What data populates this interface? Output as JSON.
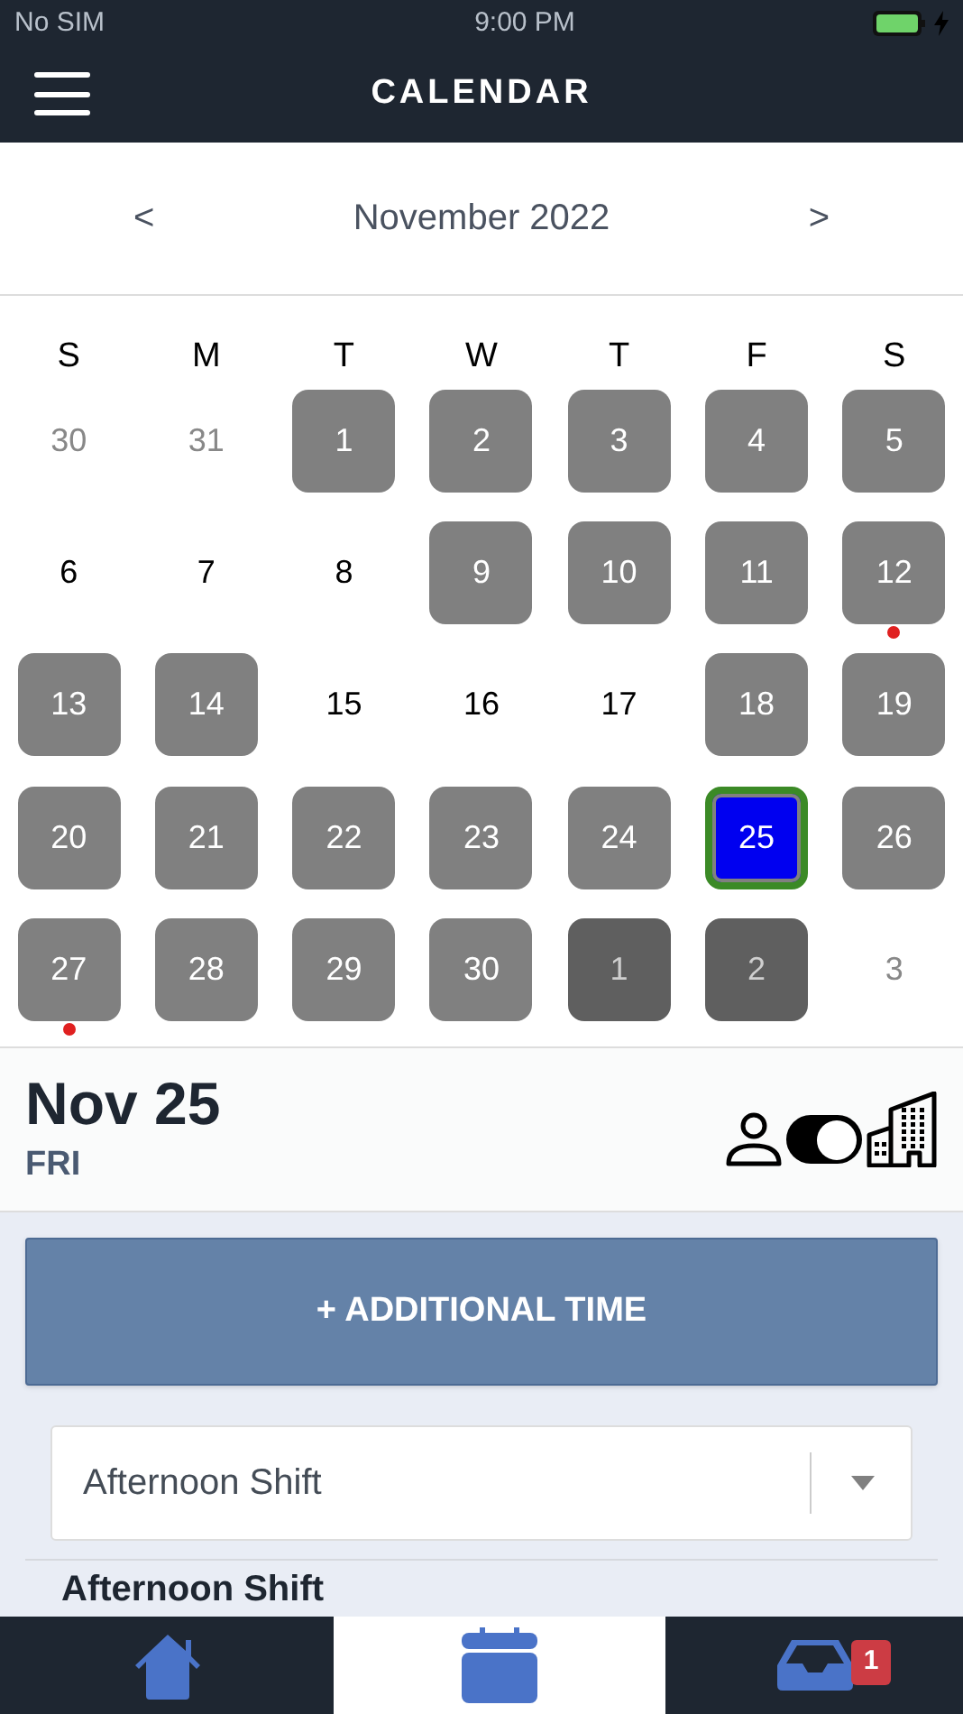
{
  "status_bar": {
    "carrier": "No SIM",
    "time": "9:00 PM",
    "charging": true
  },
  "header": {
    "title": "CALENDAR"
  },
  "month_nav": {
    "prev": "<",
    "label": "November 2022",
    "next": ">"
  },
  "weekdays": [
    "S",
    "M",
    "T",
    "W",
    "T",
    "F",
    "S"
  ],
  "days": [
    {
      "label": "30",
      "kind": "outside",
      "selected": false,
      "dot": false
    },
    {
      "label": "31",
      "kind": "outside",
      "selected": false,
      "dot": false
    },
    {
      "label": "1",
      "kind": "shift",
      "selected": false,
      "dot": false
    },
    {
      "label": "2",
      "kind": "shift",
      "selected": false,
      "dot": false
    },
    {
      "label": "3",
      "kind": "shift",
      "selected": false,
      "dot": false
    },
    {
      "label": "4",
      "kind": "shift",
      "selected": false,
      "dot": false
    },
    {
      "label": "5",
      "kind": "shift",
      "selected": false,
      "dot": false
    },
    {
      "label": "6",
      "kind": "plain",
      "selected": false,
      "dot": false
    },
    {
      "label": "7",
      "kind": "plain",
      "selected": false,
      "dot": false
    },
    {
      "label": "8",
      "kind": "plain",
      "selected": false,
      "dot": false
    },
    {
      "label": "9",
      "kind": "shift",
      "selected": false,
      "dot": false
    },
    {
      "label": "10",
      "kind": "shift",
      "selected": false,
      "dot": false
    },
    {
      "label": "11",
      "kind": "shift",
      "selected": false,
      "dot": false
    },
    {
      "label": "12",
      "kind": "shift",
      "selected": false,
      "dot": true
    },
    {
      "label": "13",
      "kind": "shift",
      "selected": false,
      "dot": false
    },
    {
      "label": "14",
      "kind": "shift",
      "selected": false,
      "dot": false
    },
    {
      "label": "15",
      "kind": "plain",
      "selected": false,
      "dot": false
    },
    {
      "label": "16",
      "kind": "plain",
      "selected": false,
      "dot": false
    },
    {
      "label": "17",
      "kind": "plain",
      "selected": false,
      "dot": false
    },
    {
      "label": "18",
      "kind": "shift",
      "selected": false,
      "dot": false
    },
    {
      "label": "19",
      "kind": "shift",
      "selected": false,
      "dot": false
    },
    {
      "label": "20",
      "kind": "shift",
      "selected": false,
      "dot": false
    },
    {
      "label": "21",
      "kind": "shift",
      "selected": false,
      "dot": false
    },
    {
      "label": "22",
      "kind": "shift",
      "selected": false,
      "dot": false
    },
    {
      "label": "23",
      "kind": "shift",
      "selected": false,
      "dot": false
    },
    {
      "label": "24",
      "kind": "shift",
      "selected": false,
      "dot": false
    },
    {
      "label": "25",
      "kind": "shift",
      "selected": true,
      "dot": false
    },
    {
      "label": "26",
      "kind": "shift",
      "selected": false,
      "dot": false
    },
    {
      "label": "27",
      "kind": "shift",
      "selected": false,
      "dot": true
    },
    {
      "label": "28",
      "kind": "shift",
      "selected": false,
      "dot": false
    },
    {
      "label": "29",
      "kind": "shift",
      "selected": false,
      "dot": false
    },
    {
      "label": "30",
      "kind": "shift",
      "selected": false,
      "dot": false
    },
    {
      "label": "1",
      "kind": "outside_shift",
      "selected": false,
      "dot": false
    },
    {
      "label": "2",
      "kind": "outside_shift",
      "selected": false,
      "dot": false
    },
    {
      "label": "3",
      "kind": "outside",
      "selected": false,
      "dot": false
    }
  ],
  "day_header": {
    "date": "Nov 25",
    "weekday": "FRI",
    "toggle_on": true
  },
  "add_button": "+ ADDITIONAL TIME",
  "shift_select": {
    "value": "Afternoon Shift"
  },
  "section_heading": "Afternoon Shift",
  "tab_bar": [
    {
      "kind": "home",
      "selected": false
    },
    {
      "kind": "calendar",
      "selected": true
    },
    {
      "kind": "inbox",
      "selected": false,
      "badge": "1"
    }
  ]
}
